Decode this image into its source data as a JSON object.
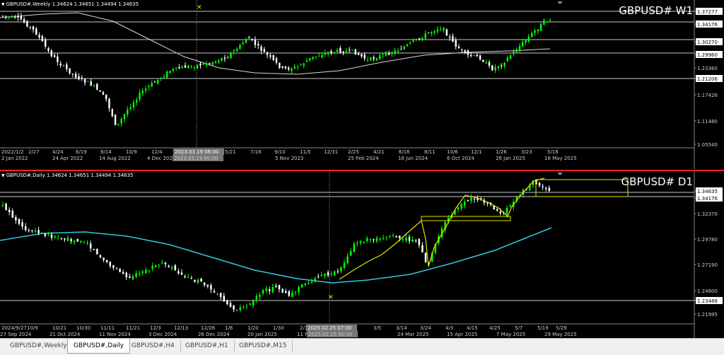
{
  "charts": [
    {
      "id": "w1",
      "header": "GBPUSD#,Weekly  1.34624 1.34651 1.34494 1.34635",
      "timeframe_label": "GBPUSD# W1",
      "price_labels": [
        "1.37277",
        "1.34176",
        "1.30270",
        "1.29960",
        "1.23360",
        "1.21206",
        "1.17426",
        "1.11480",
        "1.05540"
      ],
      "ref_line_prices": [
        "1.37277",
        "1.34176",
        "1.30270",
        "1.29960",
        "1.21206"
      ],
      "time_labels": [
        "2 Jan 2022",
        "24 Apr 2022",
        "14 Aug 2022",
        "4 Dec 2022",
        "2023.03.19 00:00",
        "5 Nov 2023",
        "25 Feb 2024",
        "16 Jun 2024",
        "6 Oct 2024",
        "26 Jan 2025",
        "18 May 2025"
      ],
      "grid_labels": [
        "2022/1/2",
        "2/27",
        "4/24",
        "6/19",
        "8/14",
        "10/9",
        "12/4",
        "5/21",
        "7/16",
        "9/10",
        "11/5",
        "12/31",
        "2/25",
        "4/21",
        "6/16",
        "8/11",
        "10/6",
        "12/1",
        "1/26",
        "3/23",
        "5/18"
      ],
      "crosshair_label": "2023.03.19 06:00",
      "crosshair_time": "2023.03.19 00:00"
    },
    {
      "id": "d1",
      "header": "GBPUSD#,Daily  1.34624 1.34651 1.34494 1.34635",
      "timeframe_label": "GBPUSD# D1",
      "price_labels": [
        "1.34635",
        "1.34176",
        "1.32370",
        "1.29780",
        "1.27190",
        "1.24600",
        "1.23488",
        "1.21995"
      ],
      "ref_line_prices": [
        "1.34635",
        "1.34176",
        "1.23488"
      ],
      "time_labels": [
        "27 Sep 2024",
        "21 Oct 2024",
        "11 Nov 2024",
        "3 Dec 2024",
        "26 Dec 2024",
        "20 Jan 2025",
        "11 Feb 2025",
        "2025.02.25 00:00",
        "24 Mar 2025",
        "15 Apr 2025",
        "7 May 2025",
        "29 May 2025"
      ],
      "grid_labels": [
        "2024/9/27",
        "10/9",
        "10/21",
        "10/30",
        "11/11",
        "11/21",
        "12/3",
        "12/13",
        "12/26",
        "1/8",
        "1/20",
        "1/30",
        "2/11",
        "3/5",
        "3/14",
        "3/24",
        "4/3",
        "4/15",
        "4/25",
        "5/7",
        "5/19",
        "5/29"
      ],
      "crosshair_label": "2025.02.25 07:00",
      "crosshair_time": "2025.02.25 00:00"
    }
  ],
  "tabs": [
    {
      "label": "GBPUSD#,Weekly",
      "active": false
    },
    {
      "label": "GBPUSD#,Daily",
      "active": true
    },
    {
      "label": "GBPUSD#,H4",
      "active": false
    },
    {
      "label": "GBPUSD#,H1",
      "active": false
    },
    {
      "label": "GBPUSD#,M15",
      "active": false
    }
  ],
  "colors": {
    "bull": "#00ff00",
    "bear": "#ffffff",
    "ma_w1": "#d8d8d8",
    "ma_d1": "#2ec8e0",
    "trend": "#e6e600",
    "ref_line": "#c8c8c8",
    "background": "#000000",
    "separator": "#ff2020"
  }
}
